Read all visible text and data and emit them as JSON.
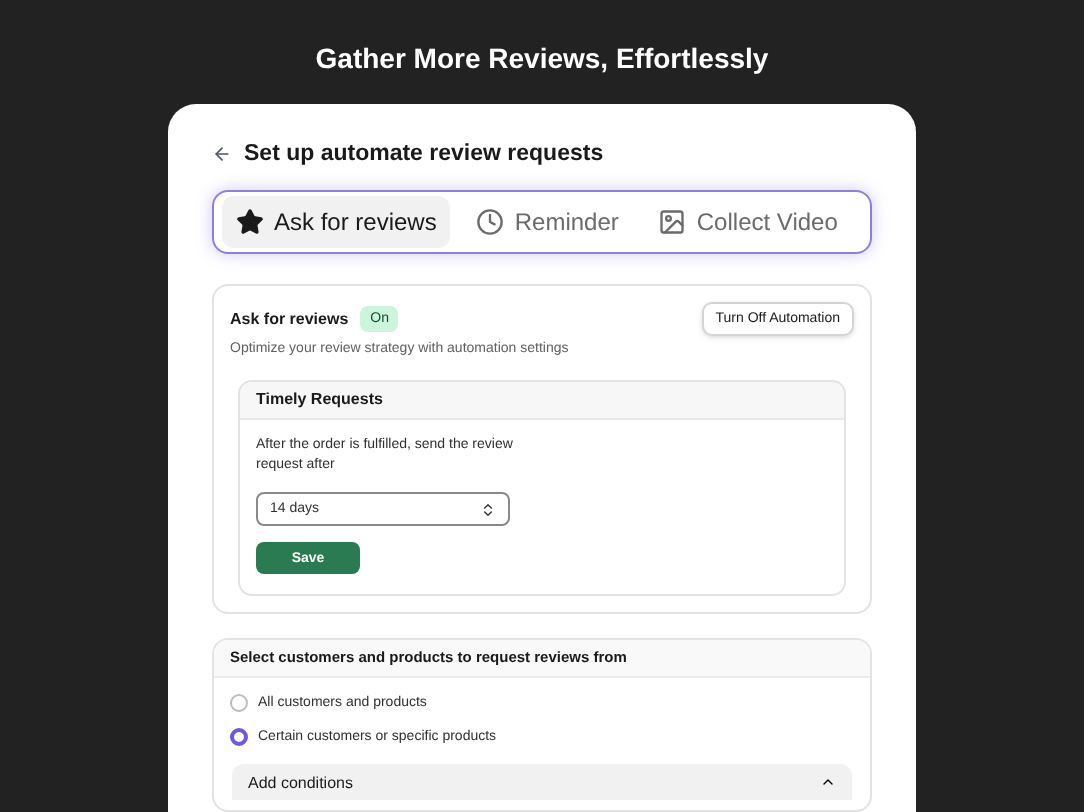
{
  "hero_title": "Gather More Reviews, Effortlessly",
  "page": {
    "title": "Set up automate review requests"
  },
  "tabs": [
    {
      "label": "Ask for reviews",
      "selected": true
    },
    {
      "label": "Reminder",
      "selected": false
    },
    {
      "label": "Collect Video",
      "selected": false
    }
  ],
  "automation": {
    "title": "Ask for reviews",
    "status": {
      "label": "On",
      "on": true
    },
    "button": "Turn Off Automation",
    "description": "Optimize your review strategy with automation settings",
    "timely": {
      "title": "Timely Requests",
      "text": "After the order is fulfilled, send the review request after",
      "select_value": "14 days",
      "save": "Save"
    }
  },
  "targeting": {
    "title": "Select customers and products to request reviews from",
    "options": [
      {
        "label": "All customers and products",
        "selected": false
      },
      {
        "label": "Certain customers or specific products",
        "selected": true
      }
    ],
    "conditions": {
      "label": "Add conditions",
      "expanded": true
    }
  }
}
